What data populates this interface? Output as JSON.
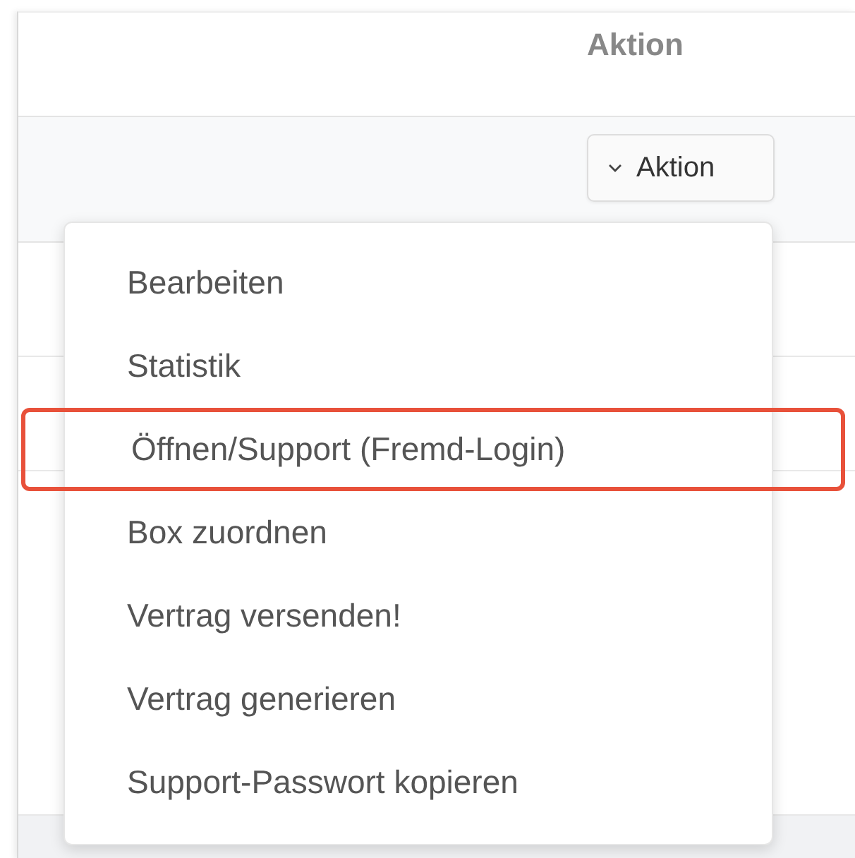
{
  "table": {
    "columns": [
      {
        "label": "Aktion"
      }
    ],
    "rows": [
      {
        "action_button": {
          "label": "Aktion",
          "expanded": true
        }
      }
    ]
  },
  "menu": {
    "items": [
      {
        "label": "Bearbeiten",
        "highlighted": false
      },
      {
        "label": "Statistik",
        "highlighted": false
      },
      {
        "label": "Öffnen/Support (Fremd-Login)",
        "highlighted": true
      },
      {
        "label": "Box zuordnen",
        "highlighted": false
      },
      {
        "label": "Vertrag versenden!",
        "highlighted": false
      },
      {
        "label": "Vertrag generieren",
        "highlighted": false
      },
      {
        "label": "Support-Passwort kopieren",
        "highlighted": false
      }
    ]
  }
}
